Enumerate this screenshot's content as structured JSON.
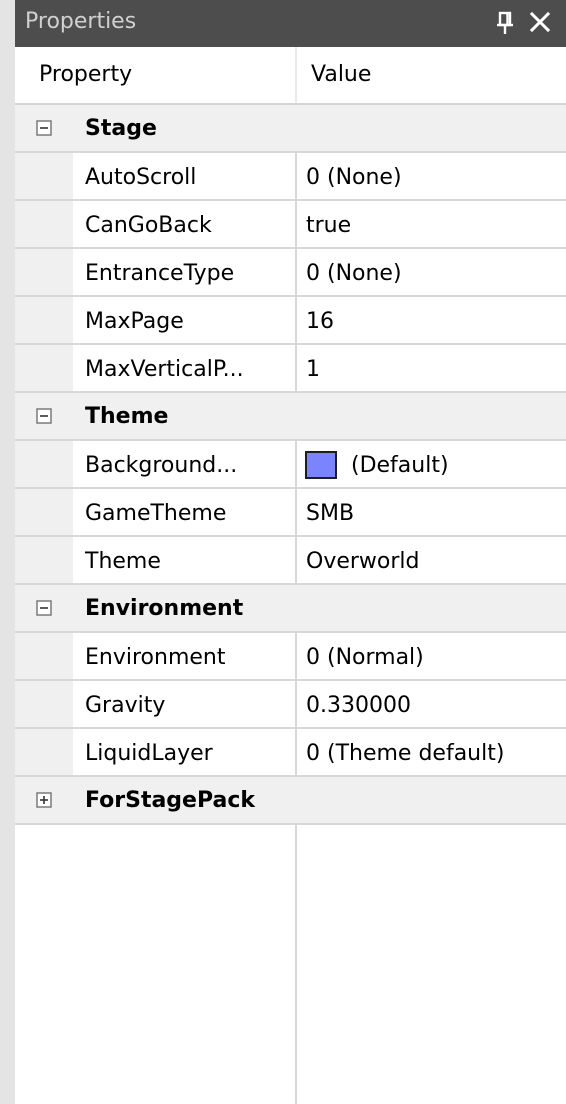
{
  "panel": {
    "title": "Properties",
    "pin_icon": "pin-icon",
    "close_icon": "close-icon"
  },
  "header": {
    "property": "Property",
    "value": "Value"
  },
  "categories": [
    {
      "name": "Stage",
      "expanded": true,
      "toggle_icon": "collapse-icon",
      "rows": [
        {
          "name": "AutoScroll",
          "value": "0 (None)"
        },
        {
          "name": "CanGoBack",
          "value": "true"
        },
        {
          "name": "EntranceType",
          "value": "0 (None)"
        },
        {
          "name": "MaxPage",
          "value": "16"
        },
        {
          "name": "MaxVerticalP...",
          "value": "1"
        }
      ]
    },
    {
      "name": "Theme",
      "expanded": true,
      "toggle_icon": "collapse-icon",
      "rows": [
        {
          "name": "Background...",
          "value": "(Default)",
          "swatch_color": "#7b84ff"
        },
        {
          "name": "GameTheme",
          "value": "SMB"
        },
        {
          "name": "Theme",
          "value": "Overworld"
        }
      ]
    },
    {
      "name": "Environment",
      "expanded": true,
      "toggle_icon": "collapse-icon",
      "rows": [
        {
          "name": "Environment",
          "value": "0 (Normal)"
        },
        {
          "name": "Gravity",
          "value": "0.330000"
        },
        {
          "name": "LiquidLayer",
          "value": "0 (Theme default)"
        }
      ]
    },
    {
      "name": "ForStagePack",
      "expanded": false,
      "toggle_icon": "expand-icon",
      "rows": []
    }
  ],
  "colors": {
    "titlebar_bg": "#4d4d4d",
    "title_text": "#d0d0d0",
    "category_bg": "#f0f0f0",
    "grid_line": "#d8d8d8",
    "background_swatch": "#7b84ff"
  }
}
